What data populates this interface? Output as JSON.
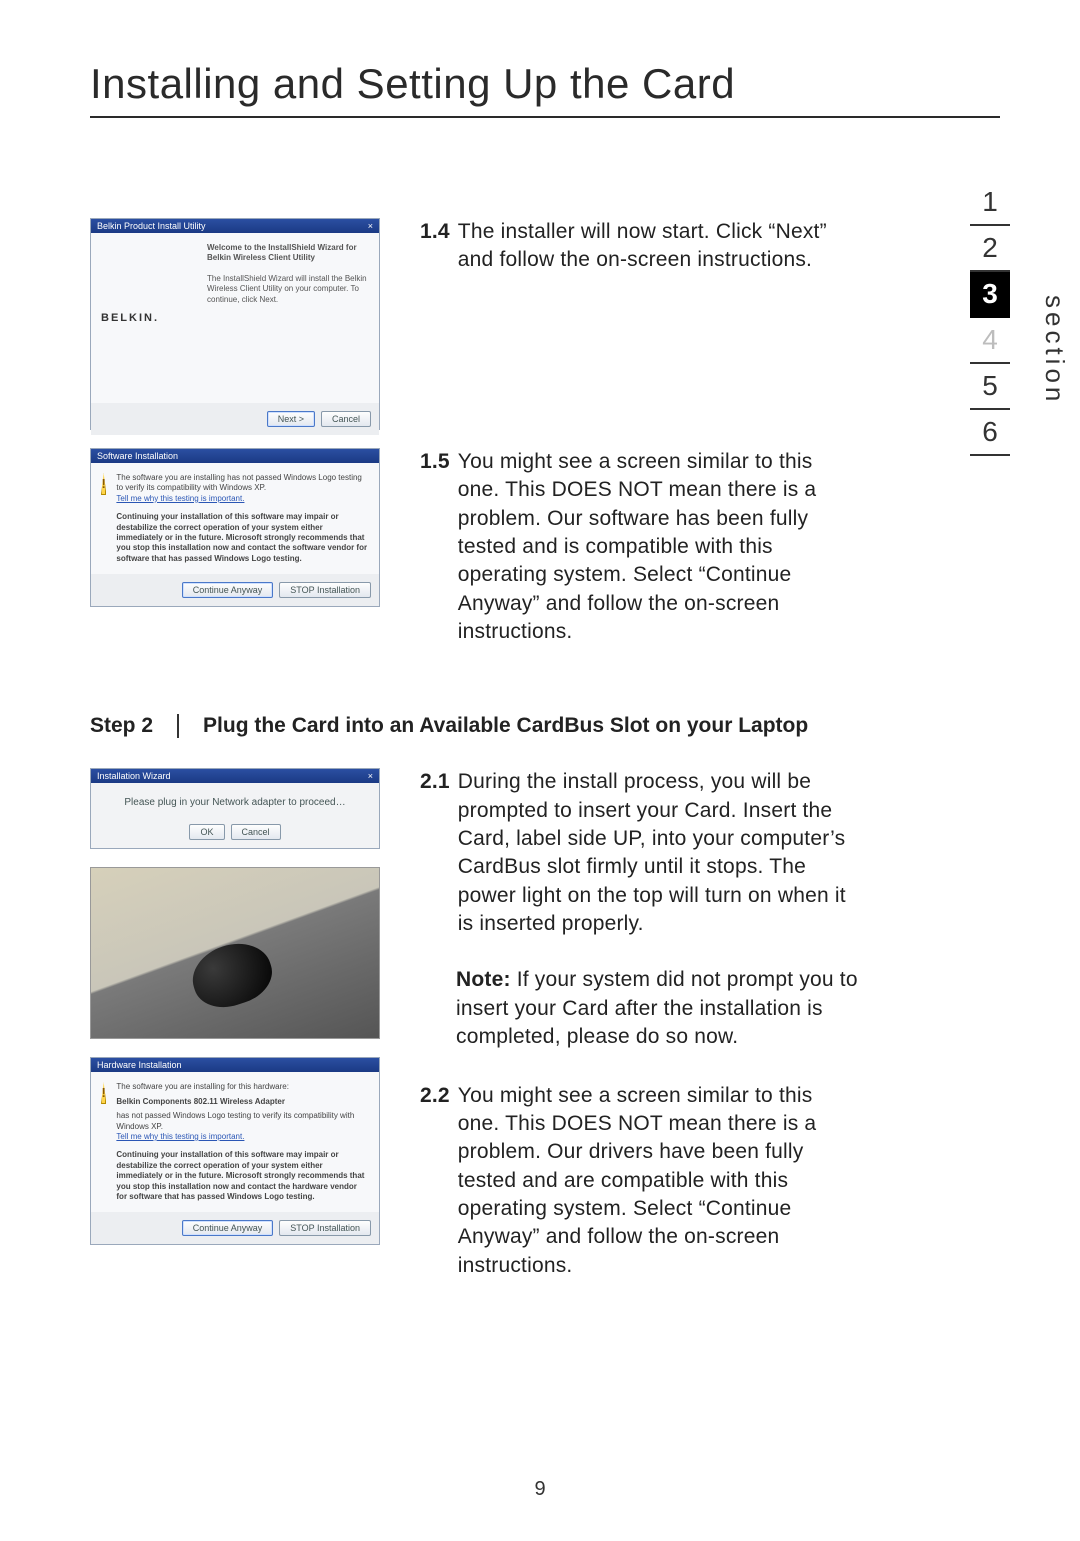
{
  "heading": "Installing and Setting Up the Card",
  "page_number": "9",
  "section_label": "section",
  "nav": {
    "items": [
      "1",
      "2",
      "3",
      "4",
      "5",
      "6"
    ],
    "active_index": 2
  },
  "instr": {
    "i1_4": {
      "num": "1.4",
      "text": "The installer will now start. Click “Next” and follow the on-screen instructions."
    },
    "i1_5": {
      "num": "1.5",
      "text": "You might see a screen similar to this one. This DOES NOT mean there is a problem. Our software has been fully tested and is compatible with this operating system. Select “Continue Anyway” and follow the on-screen instructions."
    },
    "i2_1": {
      "num": "2.1",
      "text": "During the install process, you will be prompted to insert your Card. Insert the Card, label side UP, into your computer’s CardBus slot firmly until it stops. The power light on the top will turn on when it is inserted properly."
    },
    "note": {
      "label": "Note:",
      "text": " If your system did not prompt you to insert your Card after the installation is completed, please do so now."
    },
    "i2_2": {
      "num": "2.2",
      "text": "You might see a screen similar to this one. This DOES NOT mean there is a problem. Our drivers have been fully tested and are compatible with this operating system. Select “Continue Anyway” and follow the on-screen instructions."
    }
  },
  "step2": {
    "label": "Step 2",
    "title": "Plug the Card into an Available CardBus Slot on your Laptop"
  },
  "mocks": {
    "installer": {
      "title": "Belkin Product Install Utility",
      "brand": "BELKIN.",
      "line1": "Welcome to the InstallShield Wizard for Belkin Wireless Client Utility",
      "line2": "The InstallShield Wizard will install the Belkin Wireless Client Utility on your computer. To continue, click Next.",
      "btn_next": "Next >",
      "btn_cancel": "Cancel"
    },
    "swinstall": {
      "title": "Software Installation",
      "line1": "The software you are installing has not passed Windows Logo testing to verify its compatibility with Windows XP.",
      "link": "Tell me why this testing is important.",
      "line2": "Continuing your installation of this software may impair or destabilize the correct operation of your system either immediately or in the future. Microsoft strongly recommends that you stop this installation now and contact the software vendor for software that has passed Windows Logo testing.",
      "btn_continue": "Continue Anyway",
      "btn_stop": "STOP Installation"
    },
    "wizard": {
      "title": "Installation Wizard",
      "msg": "Please plug in your Network adapter to proceed…",
      "btn_ok": "OK",
      "btn_cancel": "Cancel"
    },
    "hwinstall": {
      "title": "Hardware Installation",
      "line1": "The software you are installing for this hardware:",
      "device": "Belkin Components 802.11 Wireless Adapter",
      "line2": "has not passed Windows Logo testing to verify its compatibility with Windows XP.",
      "link": "Tell me why this testing is important.",
      "line3": "Continuing your installation of this software may impair or destabilize the correct operation of your system either immediately or in the future. Microsoft strongly recommends that you stop this installation now and contact the hardware vendor for software that has passed Windows Logo testing.",
      "btn_continue": "Continue Anyway",
      "btn_stop": "STOP Installation"
    }
  }
}
